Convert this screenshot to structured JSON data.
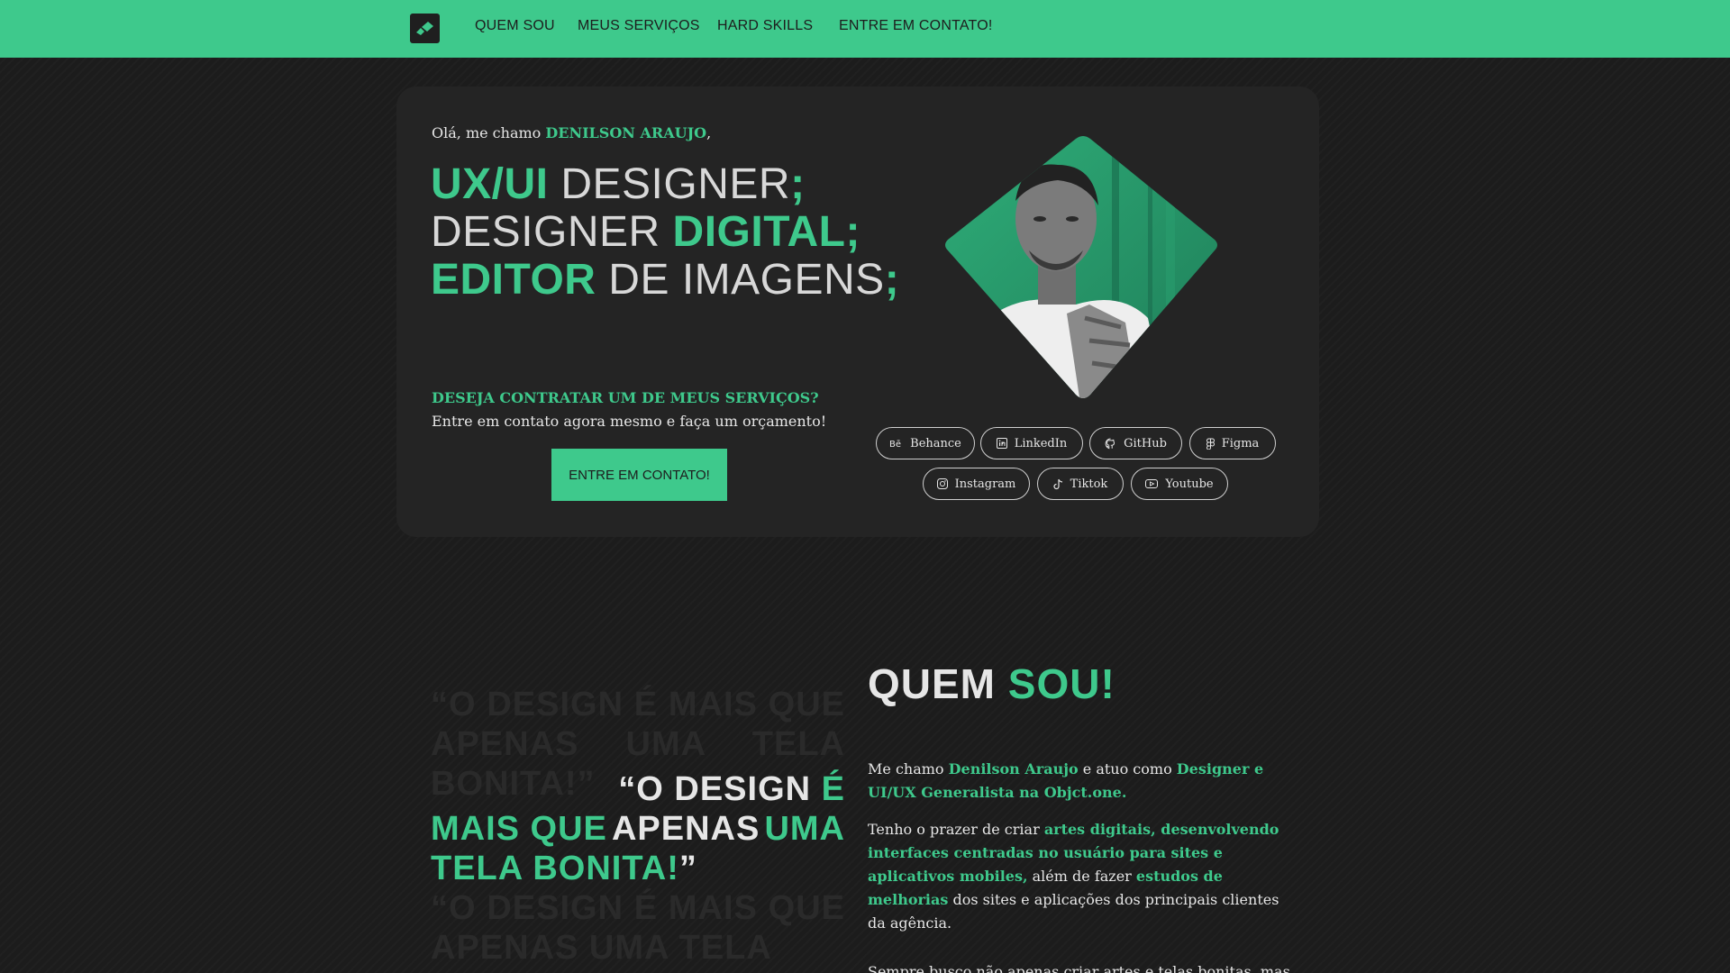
{
  "nav": {
    "links": [
      "QUEM SOU",
      "MEUS SERVIÇOS",
      "HARD SKILLS",
      "ENTRE EM CONTATO!"
    ]
  },
  "hero": {
    "greeting_prefix": "Olá, me chamo ",
    "greeting_name": "DENILSON ARAUJO",
    "greeting_suffix": ",",
    "roles": [
      {
        "part1": "UX/UI",
        "part2": " DESIGNER",
        "end": ";"
      },
      {
        "part1": "DESIGNER ",
        "part2": "DIGITAL",
        "end": ";"
      },
      {
        "part1": "EDITOR",
        "part2": " DE IMAGENS",
        "end": ";"
      }
    ],
    "cta_question": "DESEJA CONTRATAR UM DE MEUS SERVIÇOS?",
    "cta_subtitle": "Entre em contato agora mesmo e faça um orçamento!",
    "cta_button": "ENTRE EM CONTATO!",
    "socials": [
      {
        "label": "Behance",
        "icon": "behance-icon"
      },
      {
        "label": "LinkedIn",
        "icon": "linkedin-icon"
      },
      {
        "label": "GitHub",
        "icon": "github-icon"
      },
      {
        "label": "Figma",
        "icon": "figma-icon"
      },
      {
        "label": "Instagram",
        "icon": "instagram-icon"
      },
      {
        "label": "Tiktok",
        "icon": "tiktok-icon"
      },
      {
        "label": "Youtube",
        "icon": "youtube-icon"
      }
    ]
  },
  "quote": {
    "bg_text": "“O DESIGN É MAIS QUE APENAS UMA TELA BONITA!”",
    "line1_white": "“O DESIGN ",
    "line1_green": "É",
    "line2_green": "MAIS QUE ",
    "line2_white": "APENAS ",
    "line2_green2": "UMA",
    "line3_green": "TELA BONITA!",
    "line3_white": "”",
    "tail_bg": "“O DESIGN É MAIS QUE APENAS UMA TELA"
  },
  "about": {
    "title_white": "QUEM ",
    "title_green": "SOU!",
    "p1_a": "Me chamo ",
    "p1_b": "Denilson Araujo",
    "p1_c": " e atuo como ",
    "p1_d": "Designer e UI/UX Generalista na Objct.one.",
    "p2_a": "Tenho o prazer de criar ",
    "p2_b": "artes digitais, desenvolvendo interfaces centradas no usuário para sites e aplicativos mobiles,",
    "p2_c": " além de fazer ",
    "p2_d": "estudos de melhorias",
    "p2_e": " dos sites e aplicações dos principais clientes da agência.",
    "p3": "Sempre busco não apenas criar artes e telas bonitas, mas"
  },
  "colors": {
    "accent": "#3ec98c",
    "background": "#1c1c1c",
    "card": "#242424"
  }
}
